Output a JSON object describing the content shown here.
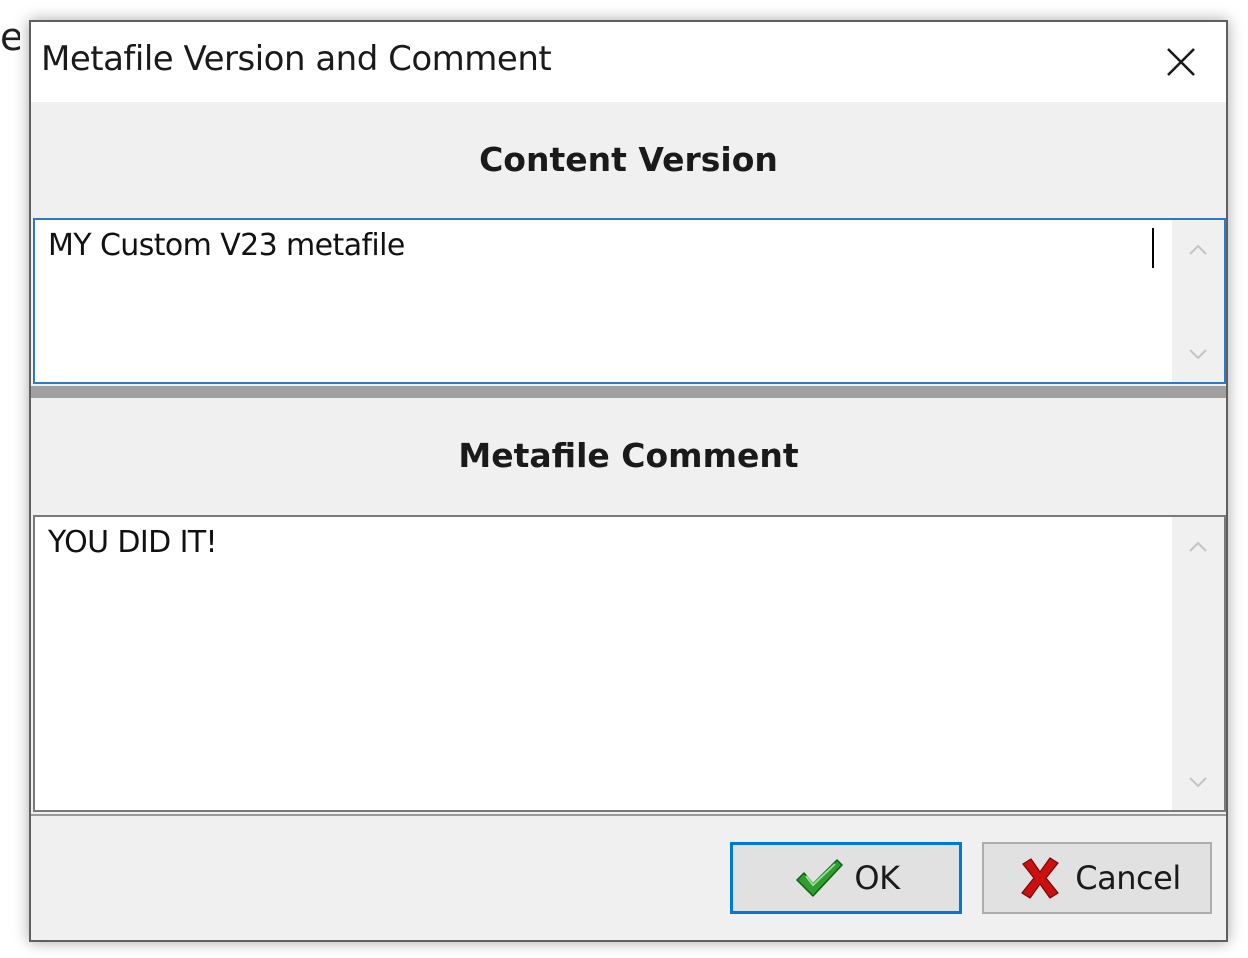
{
  "background": {
    "partial_char": "e"
  },
  "dialog": {
    "title": "Metafile Version and Comment",
    "close_icon": "close-icon",
    "content_version": {
      "header": "Content Version",
      "value": "MY Custom V23 metafile"
    },
    "metafile_comment": {
      "header": "Metafile Comment",
      "value": "YOU DID IT!"
    },
    "buttons": {
      "ok": {
        "label": "OK",
        "icon": "checkmark-icon"
      },
      "cancel": {
        "label": "Cancel",
        "icon": "x-mark-icon"
      }
    }
  },
  "colors": {
    "focus_accent": "#0078d7",
    "checkmark_green": "#2e9e2e",
    "cancel_red": "#cc1010"
  }
}
